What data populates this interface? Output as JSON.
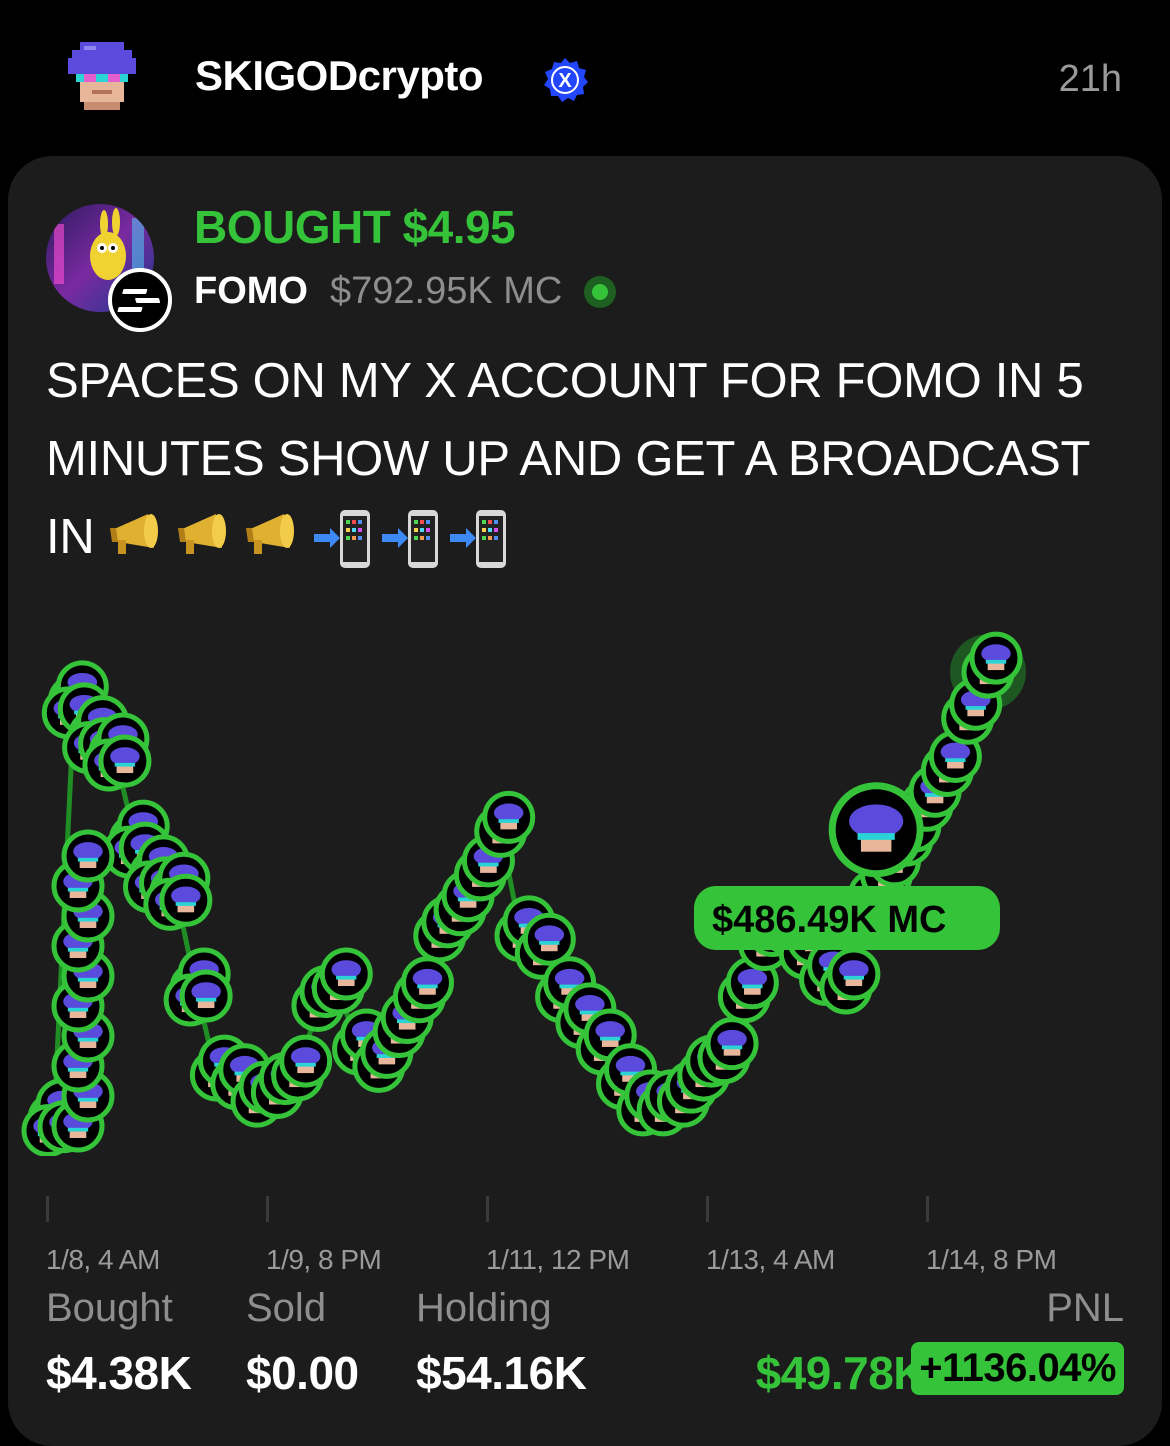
{
  "header": {
    "username": "SKIGODcrypto",
    "verified_badge": "X",
    "time_ago": "21h"
  },
  "trade": {
    "action_text": "BOUGHT $4.95",
    "token_name": "FOMO",
    "market_cap": "$792.95K MC",
    "post_text": "SPACES ON MY X ACCOUNT FOR FOMO IN 5 MINUTES SHOW UP AND GET A BROADCAST IN",
    "emojis": [
      "megaphone-icon",
      "megaphone-icon",
      "megaphone-icon",
      "mobile-arrow-icon",
      "mobile-arrow-icon",
      "mobile-arrow-icon"
    ]
  },
  "chart_data": {
    "type": "line",
    "x_ticks": [
      "1/8, 4 AM",
      "1/9, 8 PM",
      "1/11, 12 PM",
      "1/13, 4 AM",
      "1/14, 8 PM"
    ],
    "tooltip": "$486.49K MC",
    "series": [
      {
        "values_mc_k": [
          280,
          760,
          720,
          700,
          600,
          560,
          540,
          430,
          330,
          320,
          300,
          310,
          330,
          410,
          430,
          360,
          340,
          380,
          420,
          490,
          520,
          560,
          610,
          490,
          470,
          420,
          390,
          360,
          320,
          290,
          290,
          300,
          330,
          350,
          420,
          480,
          500,
          470,
          440,
          430,
          520,
          560,
          600,
          640,
          680,
          740,
          793
        ]
      }
    ],
    "colors": {
      "line": "#1f8f24",
      "accent": "#35c33a",
      "background": "#1c1c1c"
    }
  },
  "stats": {
    "bought_label": "Bought",
    "bought_value": "$4.38K",
    "sold_label": "Sold",
    "sold_value": "$0.00",
    "holding_label": "Holding",
    "holding_value": "$54.16K",
    "pnl_label": "PNL",
    "pnl_value": "$49.78K",
    "pnl_percent": "+1136.04%"
  }
}
